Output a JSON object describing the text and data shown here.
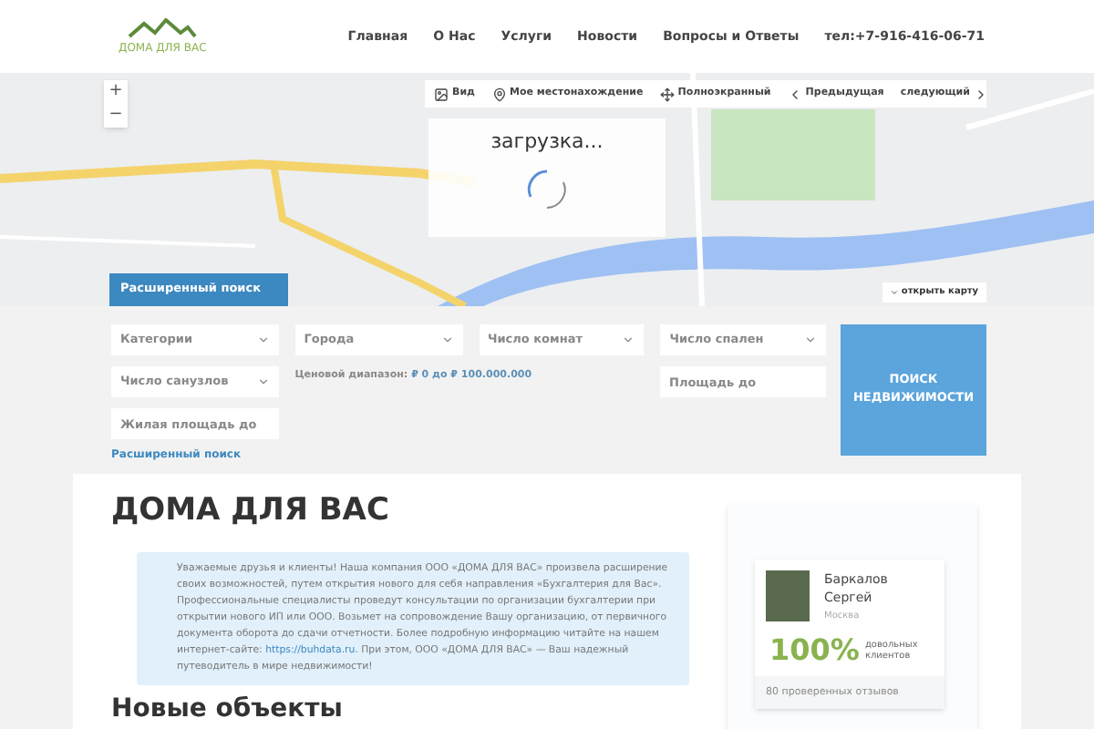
{
  "header": {
    "logo_text": "ДОМА ДЛЯ ВАС",
    "nav": [
      {
        "label": "Главная",
        "selected": false
      },
      {
        "label": "О Нас",
        "selected": false
      },
      {
        "label": "Услуги",
        "selected": false
      },
      {
        "label": "Новости",
        "selected": false
      },
      {
        "label": "Вопросы и Ответы",
        "selected": false
      }
    ],
    "phone": "тел:+7-916-416-06-71"
  },
  "map": {
    "zoom_in": "+",
    "zoom_out": "−",
    "toolbar": [
      {
        "kind": "view",
        "label": "Вид"
      },
      {
        "kind": "location",
        "label": "Мое местонахождение"
      },
      {
        "kind": "fullscreen",
        "label": "Полноэкранный"
      },
      {
        "kind": "prev",
        "label": "Предыдущая"
      },
      {
        "kind": "next",
        "label": "следующий"
      }
    ],
    "loading": "загрузка...",
    "open_map": "открыть карту"
  },
  "search": {
    "tab": "Расширенный поиск",
    "fields": [
      {
        "kind": "select",
        "placeholder": "Категории"
      },
      {
        "kind": "select",
        "placeholder": "Города"
      },
      {
        "kind": "select",
        "placeholder": "Число комнат"
      },
      {
        "kind": "select",
        "placeholder": "Число спален"
      },
      {
        "kind": "select",
        "placeholder": "Число санузлов"
      },
      {
        "kind": "input",
        "placeholder": "Площадь до"
      },
      {
        "kind": "input",
        "placeholder": "Жилая площадь до"
      }
    ],
    "price_label": "Ценовой диапазон:",
    "price_value": "₽ 0 до ₽ 100.000.000",
    "submit": "ПОИСК НЕДВИЖИМОСТИ",
    "advanced_link": "Расширенный поиск"
  },
  "content": {
    "title": "ДОМА ДЛЯ ВАС",
    "notice_before": "Уважаемые друзья и клиенты! Наша компания ООО «ДОМА ДЛЯ ВАС» произвела расширение своих возможностей, путем открытия нового для себя направления «Бухгалтерия для Вас». Профессиональные специалисты проведут консультации по организации бухгалтерии при открытии нового ИП или ООО. Возьмет на сопровождение Вашу организацию, от первичного документа оборота до сдачи отчетности. Более подробную информацию читайте на нашем интернет-сайте: ",
    "notice_link": "https://buhdata.ru",
    "notice_after": ". При этом, ООО «ДОМА ДЛЯ ВАС» — Ваш надежный путеводитель в мире недвижимости!",
    "section_title": "Новые объекты"
  },
  "agent": {
    "name": "Баркалов Сергей",
    "city": "Москва",
    "percent": "100%",
    "percent_label": "довольных клиентов",
    "reviews": "80 проверенных отзывов"
  }
}
